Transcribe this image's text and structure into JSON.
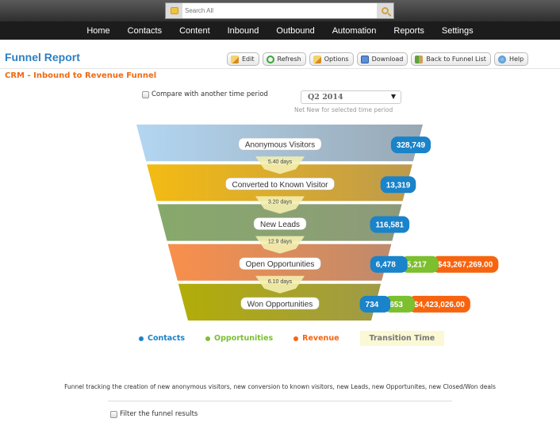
{
  "search": {
    "placeholder": "Search All"
  },
  "nav": {
    "items": [
      {
        "label": "Home"
      },
      {
        "label": "Contacts"
      },
      {
        "label": "Content"
      },
      {
        "label": "Inbound"
      },
      {
        "label": "Outbound"
      },
      {
        "label": "Automation"
      },
      {
        "label": "Reports"
      },
      {
        "label": "Settings"
      }
    ]
  },
  "page": {
    "title": "Funnel Report",
    "subtitle": "CRM - Inbound to Revenue Funnel"
  },
  "toolbar": {
    "edit": "Edit",
    "refresh": "Refresh",
    "options": "Options",
    "download": "Download",
    "back": "Back to Funnel List",
    "help": "Help"
  },
  "compare": {
    "label": "Compare with another time period",
    "checked": false
  },
  "period": {
    "selected": "Q2 2014",
    "hint": "Net New for selected time period"
  },
  "colors": {
    "contacts": "#1a83c9",
    "opportunities": "#7cbf2f",
    "revenue": "#f7640f",
    "transition": "#f3eeb0"
  },
  "funnel": {
    "stages": [
      {
        "name": "Anonymous Visitors",
        "contacts": "328,749",
        "color_start": "#b3d6f2",
        "color_end": "#98a8b4"
      },
      {
        "name": "Converted to Known Visitor",
        "contacts": "13,319",
        "color_start": "#f4bb12",
        "color_end": "#bd9a4c"
      },
      {
        "name": "New Leads",
        "contacts": "116,581",
        "color_start": "#87a96b",
        "color_end": "#8d9a7a"
      },
      {
        "name": "Open Opportunities",
        "contacts": "6,478",
        "opportunities": "5,217",
        "revenue": "$43,267,269.00",
        "color_start": "#f98f4b",
        "color_end": "#bf8a6c"
      },
      {
        "name": "Won Opportunities",
        "contacts": "734",
        "opportunities": "653",
        "revenue": "$4,423,026.00",
        "color_start": "#b2ad07",
        "color_end": "#a09a48"
      }
    ],
    "transitions": [
      "5.40 days",
      "3.20 days",
      "12.9 days",
      "6.10 days"
    ]
  },
  "legend": {
    "contacts": "Contacts",
    "opportunities": "Opportunities",
    "revenue": "Revenue",
    "transition": "Transition Time"
  },
  "description": "Funnel tracking the creation of new anonymous visitors, new conversion to known visitors, new Leads, new Opportunites, new Closed/Won deals",
  "filter": {
    "label": "Filter the funnel results",
    "checked": false
  }
}
